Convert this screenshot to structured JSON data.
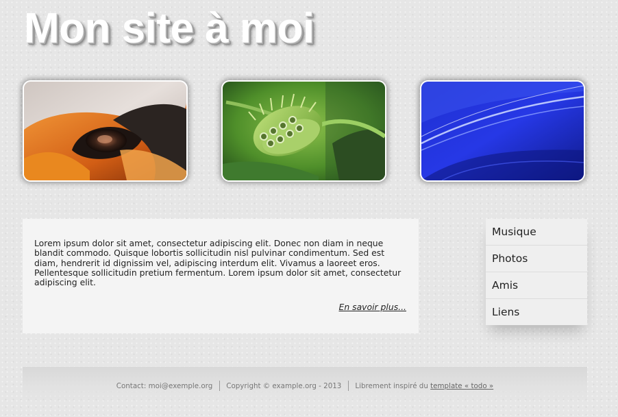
{
  "header": {
    "title": "Mon site à moi"
  },
  "gallery": {
    "photos": [
      {
        "subject": "abstract-eye-orange-render"
      },
      {
        "subject": "venus-flytrap-plant"
      },
      {
        "subject": "blue-abstract-waves"
      }
    ]
  },
  "content": {
    "paragraph": "Lorem ipsum dolor sit amet, consectetur adipiscing elit. Donec non diam in neque blandit commodo. Quisque lobortis sollicitudin nisl pulvinar condimentum. Sed est diam, hendrerit id dignissim vel, adipiscing interdum elit. Vivamus a laoreet eros. Pellentesque sollicitudin pretium fermentum. Lorem ipsum dolor sit amet, consectetur adipiscing elit.",
    "read_more": "En savoir plus..."
  },
  "menu": {
    "items": [
      {
        "label": "Musique"
      },
      {
        "label": "Photos"
      },
      {
        "label": "Amis"
      },
      {
        "label": "Liens"
      }
    ]
  },
  "footer": {
    "contact": "Contact: moi@exemple.org",
    "copyright": "Copyright © example.org - 2013",
    "inspired_prefix": "Librement inspiré du ",
    "inspired_link": "template « todo »"
  },
  "colors": {
    "background": "#e6e6e6",
    "title_text": "#ffffff",
    "content_background": "#f4f4f4",
    "menu_background": "#efefef",
    "footer_text": "#777777"
  }
}
